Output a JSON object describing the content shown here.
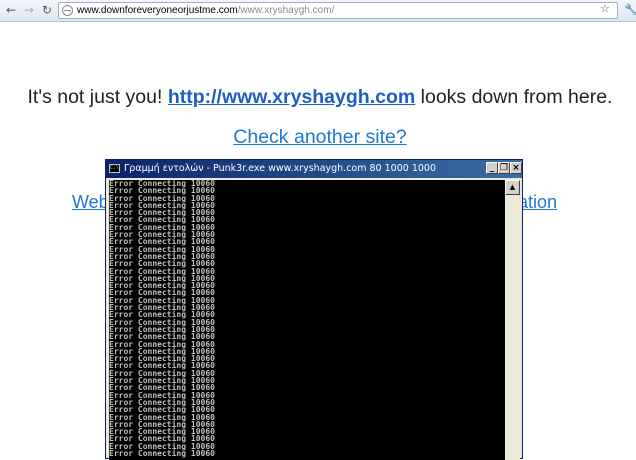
{
  "browser": {
    "url_host": "www.downforeveryoneorjustme.com",
    "url_path": "/www.xryshaygh.com/"
  },
  "page": {
    "headline_prefix": "It's not just you!",
    "headline_link": "http://www.xryshaygh.com",
    "headline_suffix": "looks down from here.",
    "check_link": "Check another site?",
    "partial_left": "Web",
    "partial_right": "ration"
  },
  "console": {
    "title": "Γραμμή εντολών - Punk3r.exe www.xryshaygh.com 80 1000 1000",
    "icon_label": "C:\\",
    "line_text": "Error Connecting 10060",
    "line_count": 38
  },
  "icons": {
    "back": "back-arrow-icon",
    "forward": "forward-arrow-icon",
    "reload": "reload-icon",
    "star": "star-icon",
    "wrench": "wrench-icon"
  }
}
